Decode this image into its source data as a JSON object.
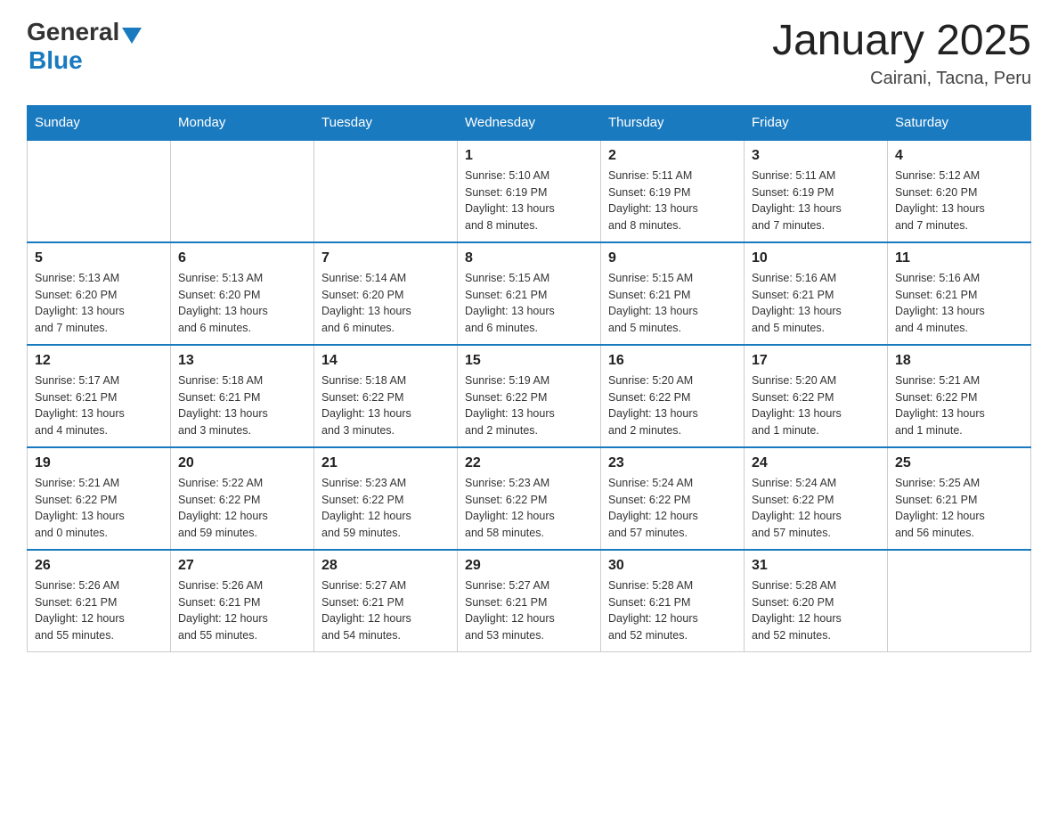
{
  "logo": {
    "general": "General",
    "blue": "Blue"
  },
  "title": "January 2025",
  "subtitle": "Cairani, Tacna, Peru",
  "weekdays": [
    "Sunday",
    "Monday",
    "Tuesday",
    "Wednesday",
    "Thursday",
    "Friday",
    "Saturday"
  ],
  "weeks": [
    [
      {
        "day": "",
        "info": ""
      },
      {
        "day": "",
        "info": ""
      },
      {
        "day": "",
        "info": ""
      },
      {
        "day": "1",
        "info": "Sunrise: 5:10 AM\nSunset: 6:19 PM\nDaylight: 13 hours\nand 8 minutes."
      },
      {
        "day": "2",
        "info": "Sunrise: 5:11 AM\nSunset: 6:19 PM\nDaylight: 13 hours\nand 8 minutes."
      },
      {
        "day": "3",
        "info": "Sunrise: 5:11 AM\nSunset: 6:19 PM\nDaylight: 13 hours\nand 7 minutes."
      },
      {
        "day": "4",
        "info": "Sunrise: 5:12 AM\nSunset: 6:20 PM\nDaylight: 13 hours\nand 7 minutes."
      }
    ],
    [
      {
        "day": "5",
        "info": "Sunrise: 5:13 AM\nSunset: 6:20 PM\nDaylight: 13 hours\nand 7 minutes."
      },
      {
        "day": "6",
        "info": "Sunrise: 5:13 AM\nSunset: 6:20 PM\nDaylight: 13 hours\nand 6 minutes."
      },
      {
        "day": "7",
        "info": "Sunrise: 5:14 AM\nSunset: 6:20 PM\nDaylight: 13 hours\nand 6 minutes."
      },
      {
        "day": "8",
        "info": "Sunrise: 5:15 AM\nSunset: 6:21 PM\nDaylight: 13 hours\nand 6 minutes."
      },
      {
        "day": "9",
        "info": "Sunrise: 5:15 AM\nSunset: 6:21 PM\nDaylight: 13 hours\nand 5 minutes."
      },
      {
        "day": "10",
        "info": "Sunrise: 5:16 AM\nSunset: 6:21 PM\nDaylight: 13 hours\nand 5 minutes."
      },
      {
        "day": "11",
        "info": "Sunrise: 5:16 AM\nSunset: 6:21 PM\nDaylight: 13 hours\nand 4 minutes."
      }
    ],
    [
      {
        "day": "12",
        "info": "Sunrise: 5:17 AM\nSunset: 6:21 PM\nDaylight: 13 hours\nand 4 minutes."
      },
      {
        "day": "13",
        "info": "Sunrise: 5:18 AM\nSunset: 6:21 PM\nDaylight: 13 hours\nand 3 minutes."
      },
      {
        "day": "14",
        "info": "Sunrise: 5:18 AM\nSunset: 6:22 PM\nDaylight: 13 hours\nand 3 minutes."
      },
      {
        "day": "15",
        "info": "Sunrise: 5:19 AM\nSunset: 6:22 PM\nDaylight: 13 hours\nand 2 minutes."
      },
      {
        "day": "16",
        "info": "Sunrise: 5:20 AM\nSunset: 6:22 PM\nDaylight: 13 hours\nand 2 minutes."
      },
      {
        "day": "17",
        "info": "Sunrise: 5:20 AM\nSunset: 6:22 PM\nDaylight: 13 hours\nand 1 minute."
      },
      {
        "day": "18",
        "info": "Sunrise: 5:21 AM\nSunset: 6:22 PM\nDaylight: 13 hours\nand 1 minute."
      }
    ],
    [
      {
        "day": "19",
        "info": "Sunrise: 5:21 AM\nSunset: 6:22 PM\nDaylight: 13 hours\nand 0 minutes."
      },
      {
        "day": "20",
        "info": "Sunrise: 5:22 AM\nSunset: 6:22 PM\nDaylight: 12 hours\nand 59 minutes."
      },
      {
        "day": "21",
        "info": "Sunrise: 5:23 AM\nSunset: 6:22 PM\nDaylight: 12 hours\nand 59 minutes."
      },
      {
        "day": "22",
        "info": "Sunrise: 5:23 AM\nSunset: 6:22 PM\nDaylight: 12 hours\nand 58 minutes."
      },
      {
        "day": "23",
        "info": "Sunrise: 5:24 AM\nSunset: 6:22 PM\nDaylight: 12 hours\nand 57 minutes."
      },
      {
        "day": "24",
        "info": "Sunrise: 5:24 AM\nSunset: 6:22 PM\nDaylight: 12 hours\nand 57 minutes."
      },
      {
        "day": "25",
        "info": "Sunrise: 5:25 AM\nSunset: 6:21 PM\nDaylight: 12 hours\nand 56 minutes."
      }
    ],
    [
      {
        "day": "26",
        "info": "Sunrise: 5:26 AM\nSunset: 6:21 PM\nDaylight: 12 hours\nand 55 minutes."
      },
      {
        "day": "27",
        "info": "Sunrise: 5:26 AM\nSunset: 6:21 PM\nDaylight: 12 hours\nand 55 minutes."
      },
      {
        "day": "28",
        "info": "Sunrise: 5:27 AM\nSunset: 6:21 PM\nDaylight: 12 hours\nand 54 minutes."
      },
      {
        "day": "29",
        "info": "Sunrise: 5:27 AM\nSunset: 6:21 PM\nDaylight: 12 hours\nand 53 minutes."
      },
      {
        "day": "30",
        "info": "Sunrise: 5:28 AM\nSunset: 6:21 PM\nDaylight: 12 hours\nand 52 minutes."
      },
      {
        "day": "31",
        "info": "Sunrise: 5:28 AM\nSunset: 6:20 PM\nDaylight: 12 hours\nand 52 minutes."
      },
      {
        "day": "",
        "info": ""
      }
    ]
  ]
}
